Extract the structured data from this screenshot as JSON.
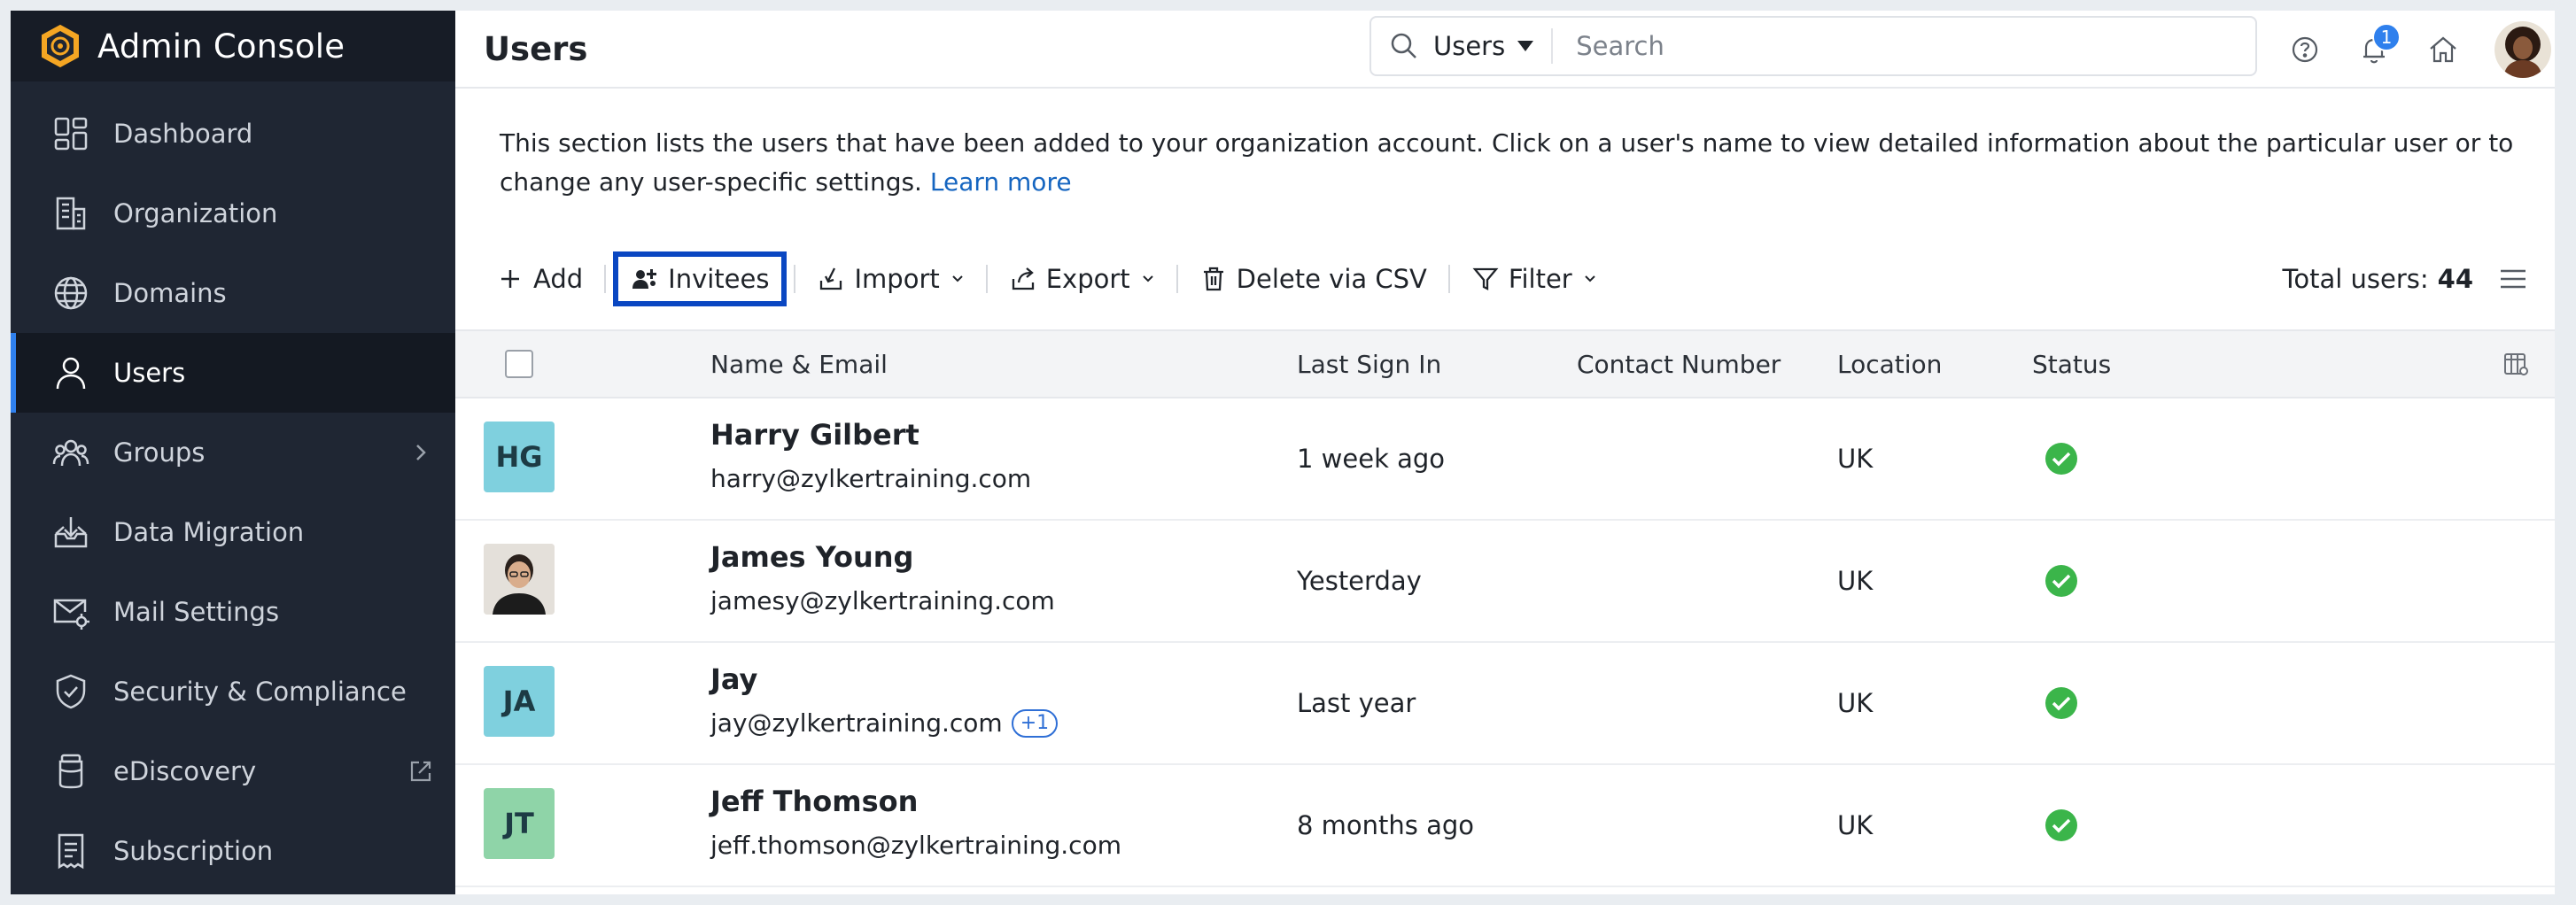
{
  "app": {
    "title": "Admin Console"
  },
  "sidebar": {
    "items": [
      {
        "label": "Dashboard",
        "icon": "dashboard-icon",
        "active": false
      },
      {
        "label": "Organization",
        "icon": "building-icon",
        "active": false
      },
      {
        "label": "Domains",
        "icon": "globe-icon",
        "active": false
      },
      {
        "label": "Users",
        "icon": "user-icon",
        "active": true
      },
      {
        "label": "Groups",
        "icon": "groups-icon",
        "active": false,
        "trail": "chevron-right-icon"
      },
      {
        "label": "Data Migration",
        "icon": "inbox-download-icon",
        "active": false
      },
      {
        "label": "Mail Settings",
        "icon": "mail-gear-icon",
        "active": false
      },
      {
        "label": "Security & Compliance",
        "icon": "shield-check-icon",
        "active": false
      },
      {
        "label": "eDiscovery",
        "icon": "archive-jar-icon",
        "active": false,
        "trail": "external-link-icon"
      },
      {
        "label": "Subscription",
        "icon": "receipt-icon",
        "active": false
      }
    ]
  },
  "header": {
    "title": "Users",
    "search": {
      "scope": "Users",
      "placeholder": "Search"
    },
    "notifications_count": "1"
  },
  "description": {
    "text": "This section lists the users that have been added to your organization account. Click on a user's name to view detailed information about the particular user or to change any user-specific settings.",
    "link": "Learn more"
  },
  "toolbar": {
    "add": "Add",
    "invitees": "Invitees",
    "import": "Import",
    "export": "Export",
    "delete_csv": "Delete via CSV",
    "filter": "Filter",
    "total_label": "Total users:",
    "total_value": "44"
  },
  "table": {
    "columns": [
      "Name & Email",
      "Last Sign In",
      "Contact Number",
      "Location",
      "Status"
    ],
    "rows": [
      {
        "initials": "HG",
        "avatar_color": "#7fd0de",
        "name": "Harry Gilbert",
        "email": "harry@zylkertraining.com",
        "extra": "",
        "last_sign_in": "1 week ago",
        "contact": "",
        "location": "UK",
        "status": "active"
      },
      {
        "initials": "",
        "avatar_color": "#e8e4df",
        "name": "James Young",
        "email": "jamesy@zylkertraining.com",
        "extra": "",
        "last_sign_in": "Yesterday",
        "contact": "",
        "location": "UK",
        "status": "active"
      },
      {
        "initials": "JA",
        "avatar_color": "#7fd0de",
        "name": "Jay",
        "email": "jay@zylkertraining.com",
        "extra": "+1",
        "last_sign_in": "Last year",
        "contact": "",
        "location": "UK",
        "status": "active"
      },
      {
        "initials": "JT",
        "avatar_color": "#8fd4a8",
        "name": "Jeff Thomson",
        "email": "jeff.thomson@zylkertraining.com",
        "extra": "",
        "last_sign_in": "8 months ago",
        "contact": "",
        "location": "UK",
        "status": "active"
      }
    ]
  },
  "colors": {
    "accent": "#2f80ed",
    "sidebar_bg": "#1f2633",
    "highlight_border": "#0a47c2",
    "status_ok": "#3bb54a"
  }
}
